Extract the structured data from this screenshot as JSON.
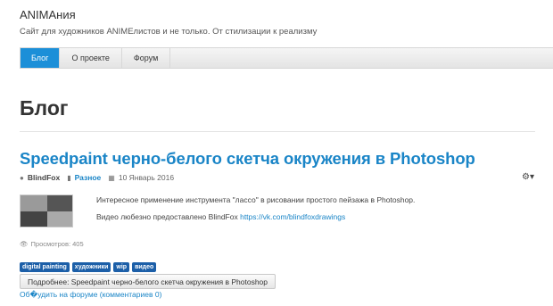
{
  "site": {
    "title": "ANIMAния",
    "description": "Сайт для художников ANIMEлистов и не только. От стилизации к реализму"
  },
  "nav": [
    {
      "label": "Блог",
      "active": true
    },
    {
      "label": "О проекте",
      "active": false
    },
    {
      "label": "Форум",
      "active": false
    }
  ],
  "page": {
    "title": "Блог"
  },
  "post": {
    "title": "Speedpaint черно-белого скетча окружения в Photoshop",
    "author": "BlindFox",
    "category": "Разное",
    "date": "10 Январь 2016",
    "text1": "Интересное применение инструмента \"лассо\" в рисовании простого пейзажа в Photoshop.",
    "text2_prefix": "Видео любезно предоставлено BlindFox",
    "text2_link": "https://vk.com/blindfoxdrawings",
    "views": "Просмотров: 405",
    "tags": [
      "digital painting",
      "художники",
      "wip",
      "видео"
    ],
    "more_button": "Подробнее: Speedpaint черно-белого скетча окружения в Photoshop",
    "discuss_link": "Об�удить на форуме (комментариев 0)"
  },
  "icons": {
    "author": "user-icon",
    "category": "folder-icon",
    "date": "calendar-icon",
    "views": "eye-icon",
    "options": "gear-icon"
  },
  "colors": {
    "accent": "#1c8fd8",
    "link": "#1a85c7",
    "tag": "#1c5fa8"
  }
}
